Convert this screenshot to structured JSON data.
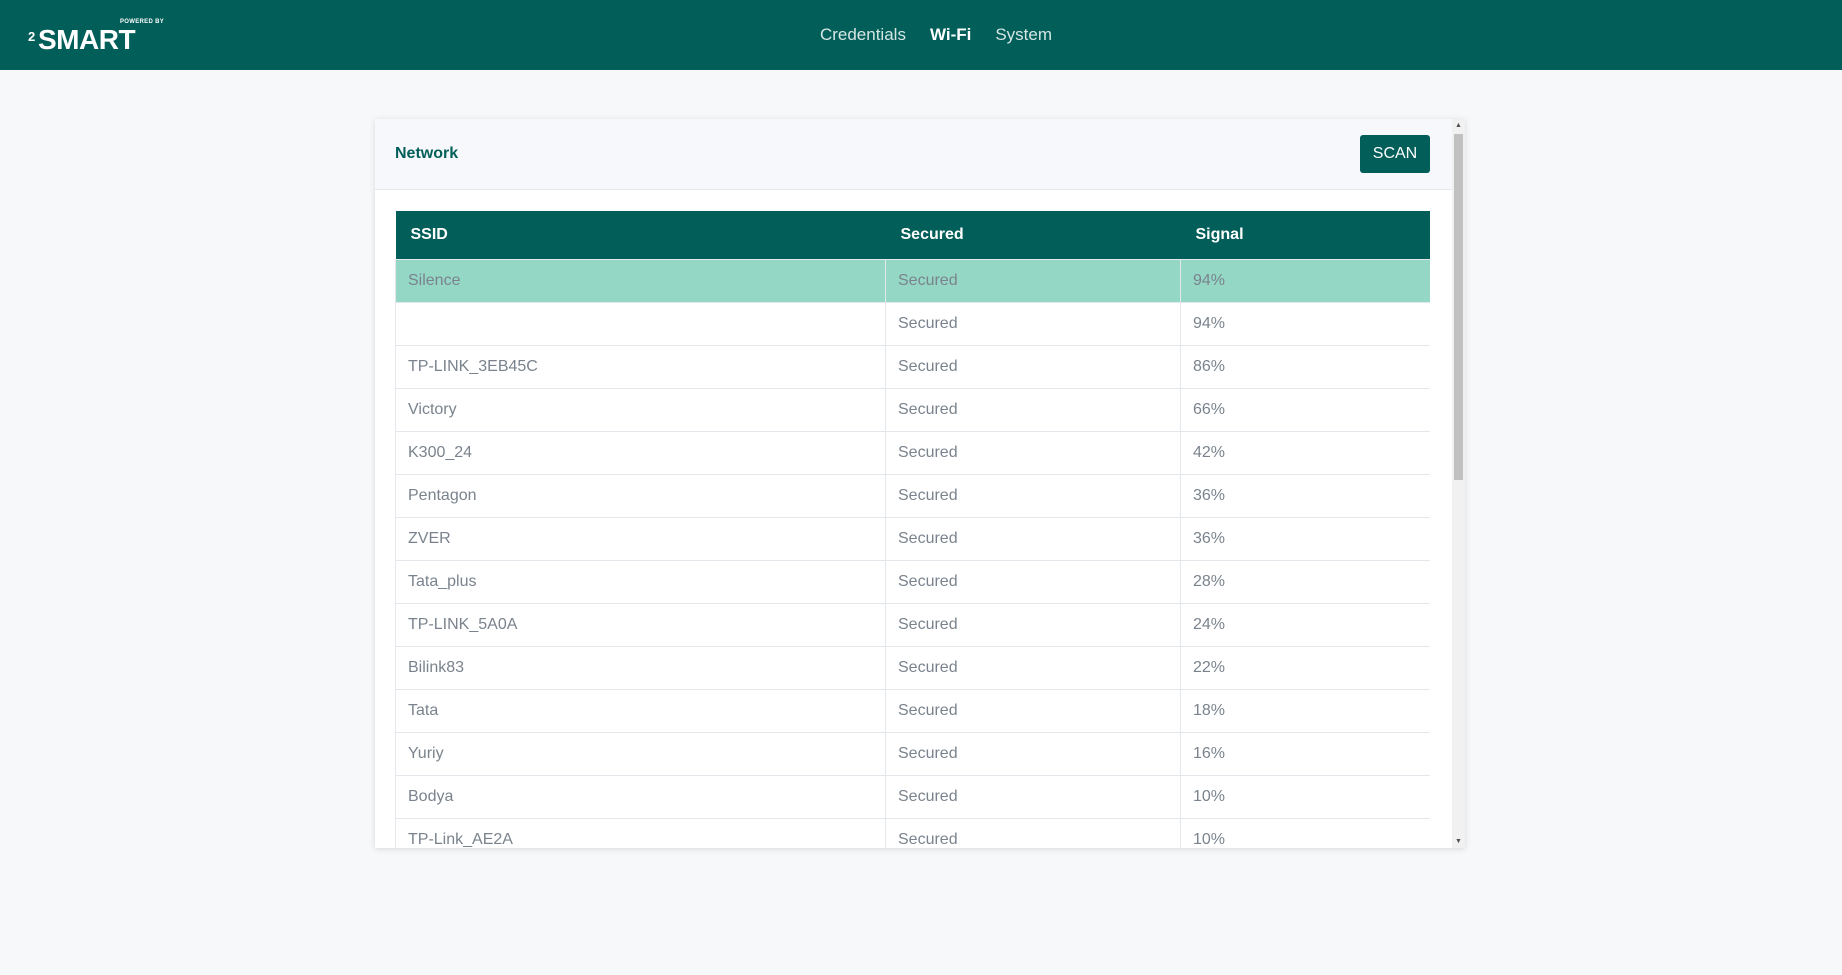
{
  "brand": {
    "powered_by": "POWERED BY",
    "superscript": "2",
    "name": "SMART"
  },
  "nav": {
    "items": [
      {
        "label": "Credentials"
      },
      {
        "label": "Wi-Fi",
        "active": true
      },
      {
        "label": "System"
      }
    ]
  },
  "panel": {
    "title": "Network",
    "scan_label": "SCAN"
  },
  "table": {
    "columns": [
      "SSID",
      "Secured",
      "Signal"
    ],
    "rows": [
      {
        "ssid": "Silence",
        "secured": "Secured",
        "signal": "94%",
        "selected": true
      },
      {
        "ssid": "",
        "secured": "Secured",
        "signal": "94%"
      },
      {
        "ssid": "TP-LINK_3EB45C",
        "secured": "Secured",
        "signal": "86%"
      },
      {
        "ssid": "Victory",
        "secured": "Secured",
        "signal": "66%"
      },
      {
        "ssid": "K300_24",
        "secured": "Secured",
        "signal": "42%"
      },
      {
        "ssid": "Pentagon",
        "secured": "Secured",
        "signal": "36%"
      },
      {
        "ssid": "ZVER",
        "secured": "Secured",
        "signal": "36%"
      },
      {
        "ssid": "Tata_plus",
        "secured": "Secured",
        "signal": "28%"
      },
      {
        "ssid": "TP-LINK_5A0A",
        "secured": "Secured",
        "signal": "24%"
      },
      {
        "ssid": "Bilink83",
        "secured": "Secured",
        "signal": "22%"
      },
      {
        "ssid": "Tata",
        "secured": "Secured",
        "signal": "18%"
      },
      {
        "ssid": "Yuriy",
        "secured": "Secured",
        "signal": "16%"
      },
      {
        "ssid": "Bodya",
        "secured": "Secured",
        "signal": "10%"
      },
      {
        "ssid": "TP-Link_AE2A",
        "secured": "Secured",
        "signal": "10%"
      }
    ]
  },
  "colors": {
    "brand": "#015e59",
    "selected_row": "#94d7c5",
    "page_background": "#f6f8fa"
  },
  "icons": {
    "scroll_up": "scroll-up-arrow-icon",
    "scroll_down": "scroll-down-arrow-icon"
  }
}
